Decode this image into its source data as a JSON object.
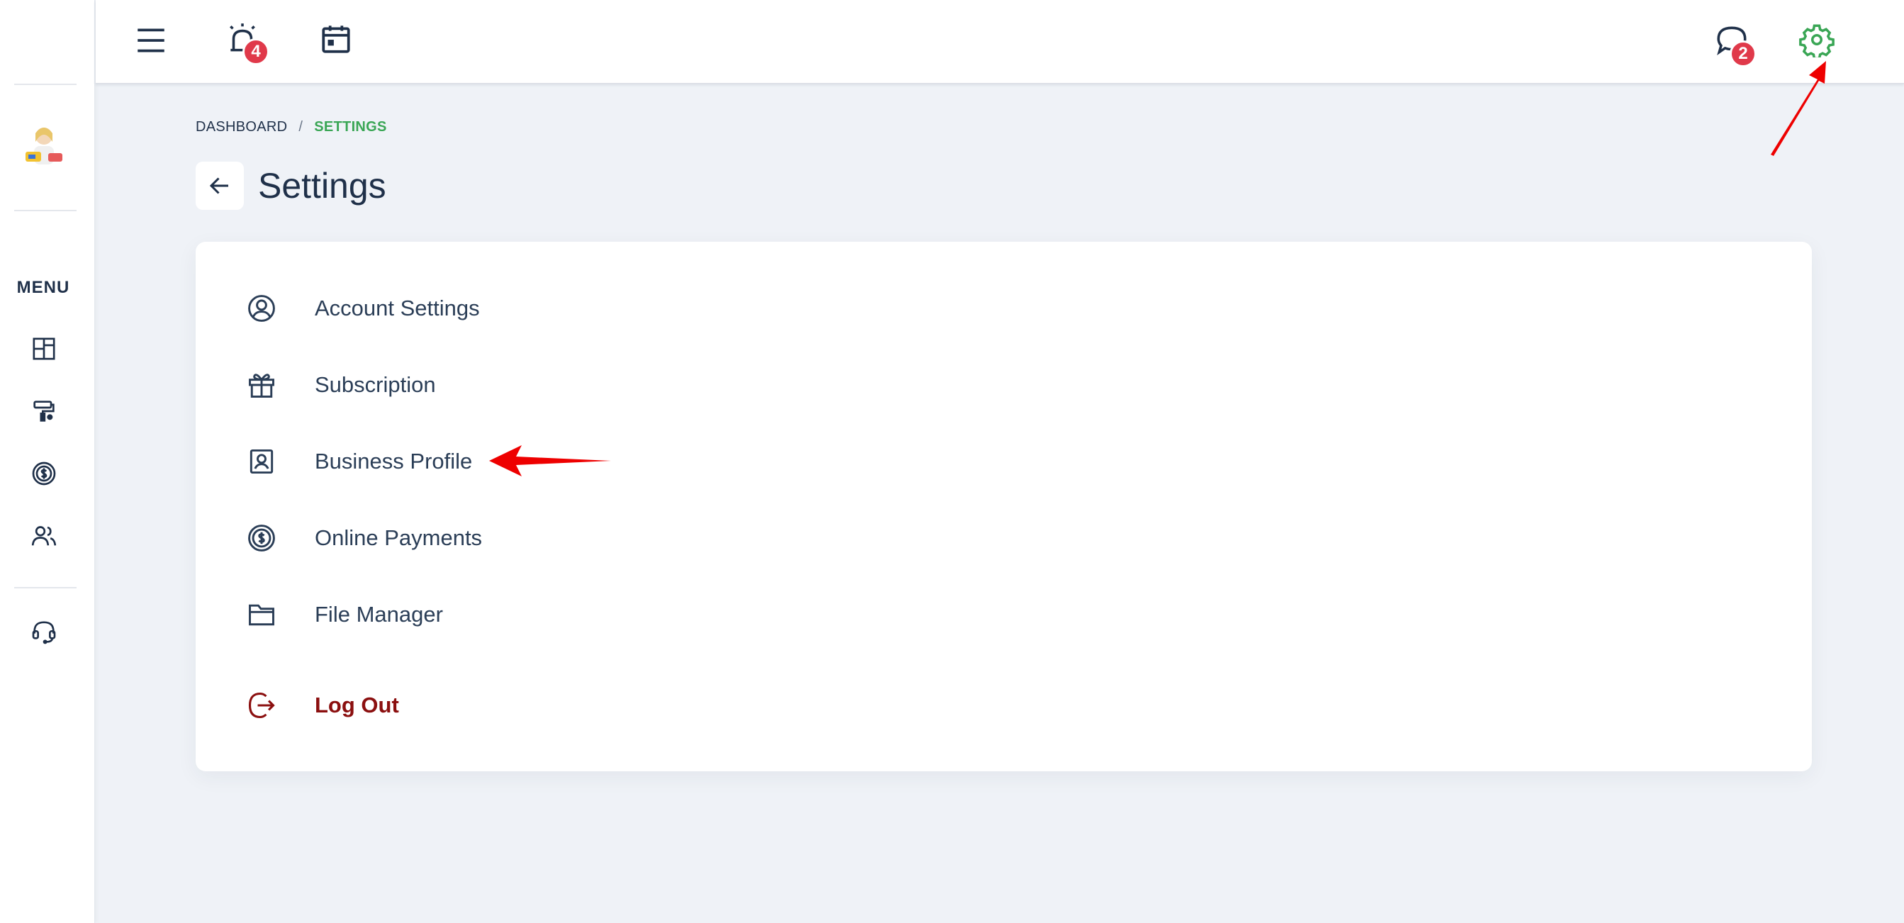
{
  "sidebar": {
    "menu_label": "MENU",
    "icons": [
      "dashboard-icon",
      "paint-roller-icon",
      "dollar-circle-icon",
      "users-icon",
      "headset-icon"
    ]
  },
  "topbar": {
    "menu_icon": "hamburger-icon",
    "alarm_icon": "alarm-icon",
    "alarm_badge": "4",
    "calendar_icon": "calendar-icon",
    "chat_icon": "chat-bubble-icon",
    "chat_badge": "2",
    "settings_icon": "gear-icon"
  },
  "breadcrumb": {
    "root": "DASHBOARD",
    "separator": "/",
    "current": "SETTINGS"
  },
  "page": {
    "title": "Settings"
  },
  "settings_menu": {
    "items": [
      {
        "label": "Account Settings",
        "icon": "user-circle-icon"
      },
      {
        "label": "Subscription",
        "icon": "gift-icon"
      },
      {
        "label": "Business Profile",
        "icon": "id-badge-icon"
      },
      {
        "label": "Online Payments",
        "icon": "dollar-circle-icon"
      },
      {
        "label": "File Manager",
        "icon": "folder-icon"
      }
    ],
    "logout_label": "Log Out"
  },
  "colors": {
    "accent_green": "#3aa655",
    "badge_red": "#e0394a",
    "logout_red": "#8b0f0f",
    "annotation_red": "#ee0000",
    "text_dark": "#1f3049",
    "background": "#eff2f7"
  }
}
